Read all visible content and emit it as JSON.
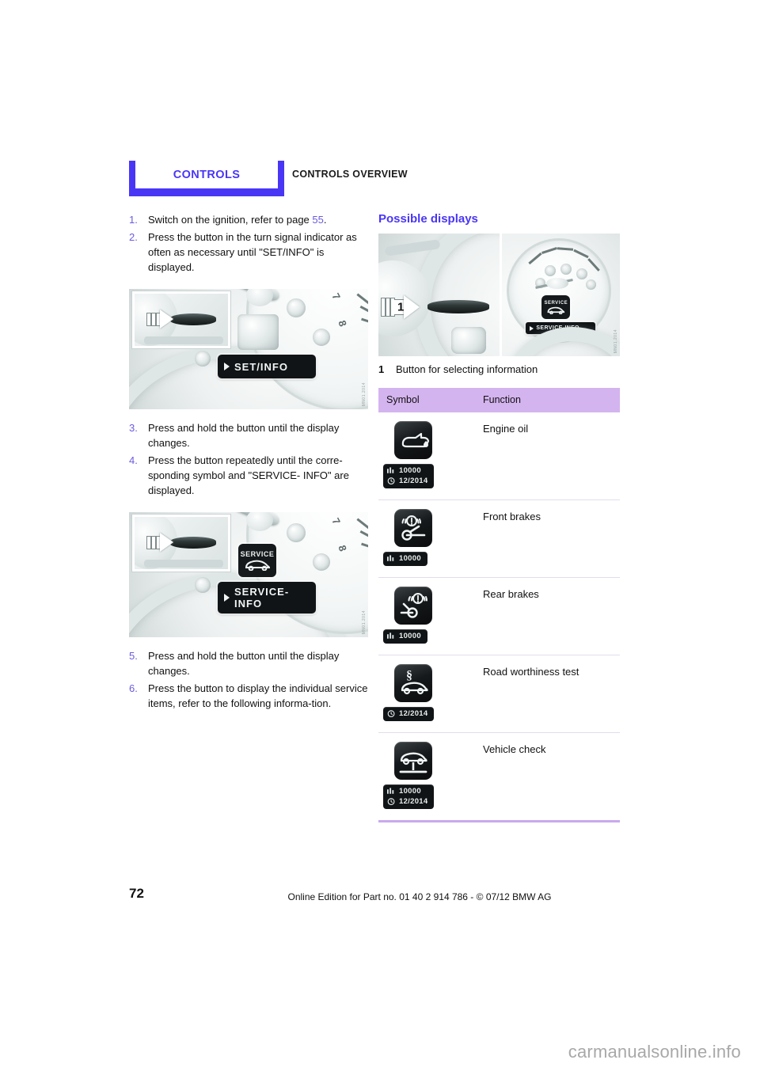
{
  "header": {
    "tab_label": "CONTROLS",
    "chapter": "CONTROLS OVERVIEW"
  },
  "left_column": {
    "steps": [
      {
        "num": "1.",
        "text": "Switch on the ignition, refer to page ",
        "page_ref": "55",
        "tail": "."
      },
      {
        "num": "2.",
        "text": "Press the button in the turn signal indicator as often as necessary until \"SET/INFO\" is displayed."
      },
      {
        "num": "3.",
        "text": "Press and hold the button until the display changes."
      },
      {
        "num": "4.",
        "text": "Press the button repeatedly until the corre-sponding symbol and \"SERVICE- INFO\" are displayed."
      },
      {
        "num": "5.",
        "text": "Press and hold the button until the display changes."
      },
      {
        "num": "6.",
        "text": "Press the button to display the individual service items, refer to the following informa-tion."
      }
    ],
    "figure_1": {
      "lcd_text": "SET/INFO",
      "dial_numbers": [
        "7",
        "8"
      ],
      "code": "MN01.2014"
    },
    "figure_2": {
      "lcd_text": "SERVICE-\nINFO",
      "badge_text": "SERVICE",
      "dial_numbers": [
        "7",
        "8"
      ],
      "code": "MN01.2014"
    }
  },
  "right_column": {
    "section_title": "Possible displays",
    "figure_3": {
      "arrow_label": "1",
      "badge_text": "SERVICE",
      "lcd_text": "SERVICE-INFO",
      "code": "MN01.2014"
    },
    "legend": {
      "num": "1",
      "text": "Button for selecting information"
    },
    "table": {
      "columns": [
        "Symbol",
        "Function"
      ],
      "rows": [
        {
          "icon": "engine-oil-icon",
          "function": "Engine oil",
          "chips": [
            {
              "icon": "distance-icon",
              "value": "10000"
            },
            {
              "icon": "clock-icon",
              "value": "12/2014"
            }
          ]
        },
        {
          "icon": "front-brakes-icon",
          "function": "Front brakes",
          "chips": [
            {
              "icon": "distance-icon",
              "value": "10000"
            }
          ]
        },
        {
          "icon": "rear-brakes-icon",
          "function": "Rear brakes",
          "chips": [
            {
              "icon": "distance-icon",
              "value": "10000"
            }
          ]
        },
        {
          "icon": "road-worthiness-icon",
          "function": "Road worthiness test",
          "chips": [
            {
              "icon": "clock-icon",
              "value": "12/2014"
            }
          ]
        },
        {
          "icon": "vehicle-check-icon",
          "function": "Vehicle check",
          "chips": [
            {
              "icon": "distance-icon",
              "value": "10000"
            },
            {
              "icon": "clock-icon",
              "value": "12/2014"
            }
          ]
        }
      ]
    }
  },
  "footer": {
    "page_number": "72",
    "imprint": "Online Edition for Part no. 01 40 2 914 786 - © 07/12 BMW AG",
    "watermark": "carmanualsonline.info"
  },
  "colors": {
    "accent": "#4936f5",
    "step_number": "#6a5bdd",
    "table_header_bg": "#d4b4ef",
    "table_rule": "#c9a9ee"
  }
}
